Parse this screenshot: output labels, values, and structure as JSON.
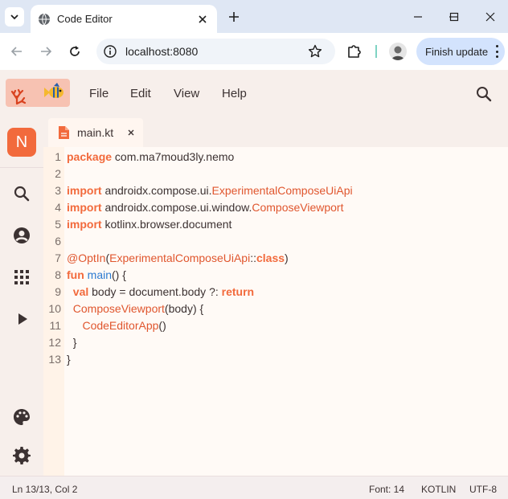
{
  "browser": {
    "tab_title": "Code Editor",
    "url": "localhost:8080",
    "update_label": "Finish update"
  },
  "app": {
    "menu": [
      "File",
      "Edit",
      "View",
      "Help"
    ],
    "rail_badge": "N",
    "file_tab": "main.kt",
    "colors": {
      "accent": "#f26a3c",
      "keyword": "#f26a3c",
      "type": "#e0562e",
      "function": "#2b7bd1"
    }
  },
  "editor": {
    "lines": [
      {
        "n": "1",
        "parts": [
          [
            "kw",
            "package"
          ],
          [
            "p",
            " com.ma7moud3ly.nemo"
          ]
        ]
      },
      {
        "n": "2",
        "parts": []
      },
      {
        "n": "3",
        "parts": [
          [
            "kw",
            "import"
          ],
          [
            "p",
            " androidx.compose.ui."
          ],
          [
            "ty",
            "ExperimentalComposeUiApi"
          ]
        ]
      },
      {
        "n": "4",
        "parts": [
          [
            "kw",
            "import"
          ],
          [
            "p",
            " androidx.compose.ui.window."
          ],
          [
            "ty",
            "ComposeViewport"
          ]
        ]
      },
      {
        "n": "5",
        "parts": [
          [
            "kw",
            "import"
          ],
          [
            "p",
            " kotlinx.browser.document"
          ]
        ]
      },
      {
        "n": "6",
        "parts": []
      },
      {
        "n": "7",
        "parts": [
          [
            "an",
            "@OptIn"
          ],
          [
            "p",
            "("
          ],
          [
            "ty",
            "ExperimentalComposeUiApi"
          ],
          [
            "p",
            "::"
          ],
          [
            "kw",
            "class"
          ],
          [
            "p",
            ")"
          ]
        ]
      },
      {
        "n": "8",
        "parts": [
          [
            "kw",
            "fun"
          ],
          [
            "p",
            " "
          ],
          [
            "fn",
            "main"
          ],
          [
            "p",
            "() {"
          ]
        ]
      },
      {
        "n": "9",
        "parts": [
          [
            "p",
            "  "
          ],
          [
            "kw",
            "val"
          ],
          [
            "p",
            " body = document.body ?: "
          ],
          [
            "kw",
            "return"
          ]
        ]
      },
      {
        "n": "10",
        "parts": [
          [
            "p",
            "  "
          ],
          [
            "call",
            "ComposeViewport"
          ],
          [
            "p",
            "(body) {"
          ]
        ]
      },
      {
        "n": "11",
        "parts": [
          [
            "p",
            "     "
          ],
          [
            "call",
            "CodeEditorApp"
          ],
          [
            "p",
            "()"
          ]
        ]
      },
      {
        "n": "12",
        "parts": [
          [
            "p",
            "  }"
          ]
        ]
      },
      {
        "n": "13",
        "parts": [
          [
            "p",
            "}"
          ]
        ]
      }
    ]
  },
  "status": {
    "position": "Ln 13/13, Col 2",
    "font": "Font: 14",
    "language": "KOTLIN",
    "encoding": "UTF-8"
  }
}
